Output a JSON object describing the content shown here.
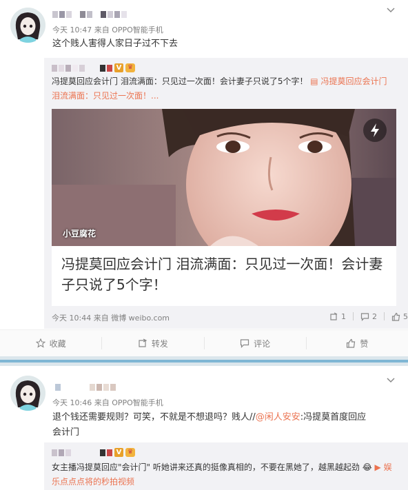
{
  "post1": {
    "meta": "今天 10:47 来自 OPPO智能手机",
    "text": "这个贱人害得人家日子过不下去",
    "repost": {
      "vbadge": "V",
      "text": "冯提莫回应会计门 泪流满面：只见过一次面！会计妻子只说了5个字！",
      "link_text": "冯提莫回应会计门",
      "line2": "泪流满面：只见过一次面！...",
      "card": {
        "watermark": "小豆腐花",
        "title": "冯提莫回应会计门 泪流满面：只见过一次面！会计妻子只说了5个字！"
      },
      "meta": "今天 10:44 来自 微博 weibo.com",
      "reposts": "1",
      "comments": "2",
      "likes": "5"
    },
    "actions": {
      "favorite": "收藏",
      "repost": "转发",
      "comment": "评论",
      "like": "赞"
    }
  },
  "post2": {
    "meta": "今天 10:46 来自 OPPO智能手机",
    "text_a": "退个钱还需要规则？可笑，不就是不想退吗？贱人//",
    "mention": "@闲人安安",
    "text_b": ":冯提莫首度回应",
    "text_c": "会计门",
    "repost": {
      "vbadge": "V",
      "text": "女主播冯提莫回应\"会计门\" 听她讲来还真的挺像真相的，不要在黑她了，越黑越起劲",
      "link_text": "娱",
      "line2": "乐点点点将的秒拍视频"
    }
  },
  "colors": {
    "accent": "#eb7350",
    "separator": "#7fb6d4",
    "repost_bg": "#f2f2f5"
  },
  "icons": [
    "chevron-down-icon",
    "flash-icon",
    "repost-icon",
    "comment-icon",
    "like-icon",
    "favorite-icon"
  ]
}
